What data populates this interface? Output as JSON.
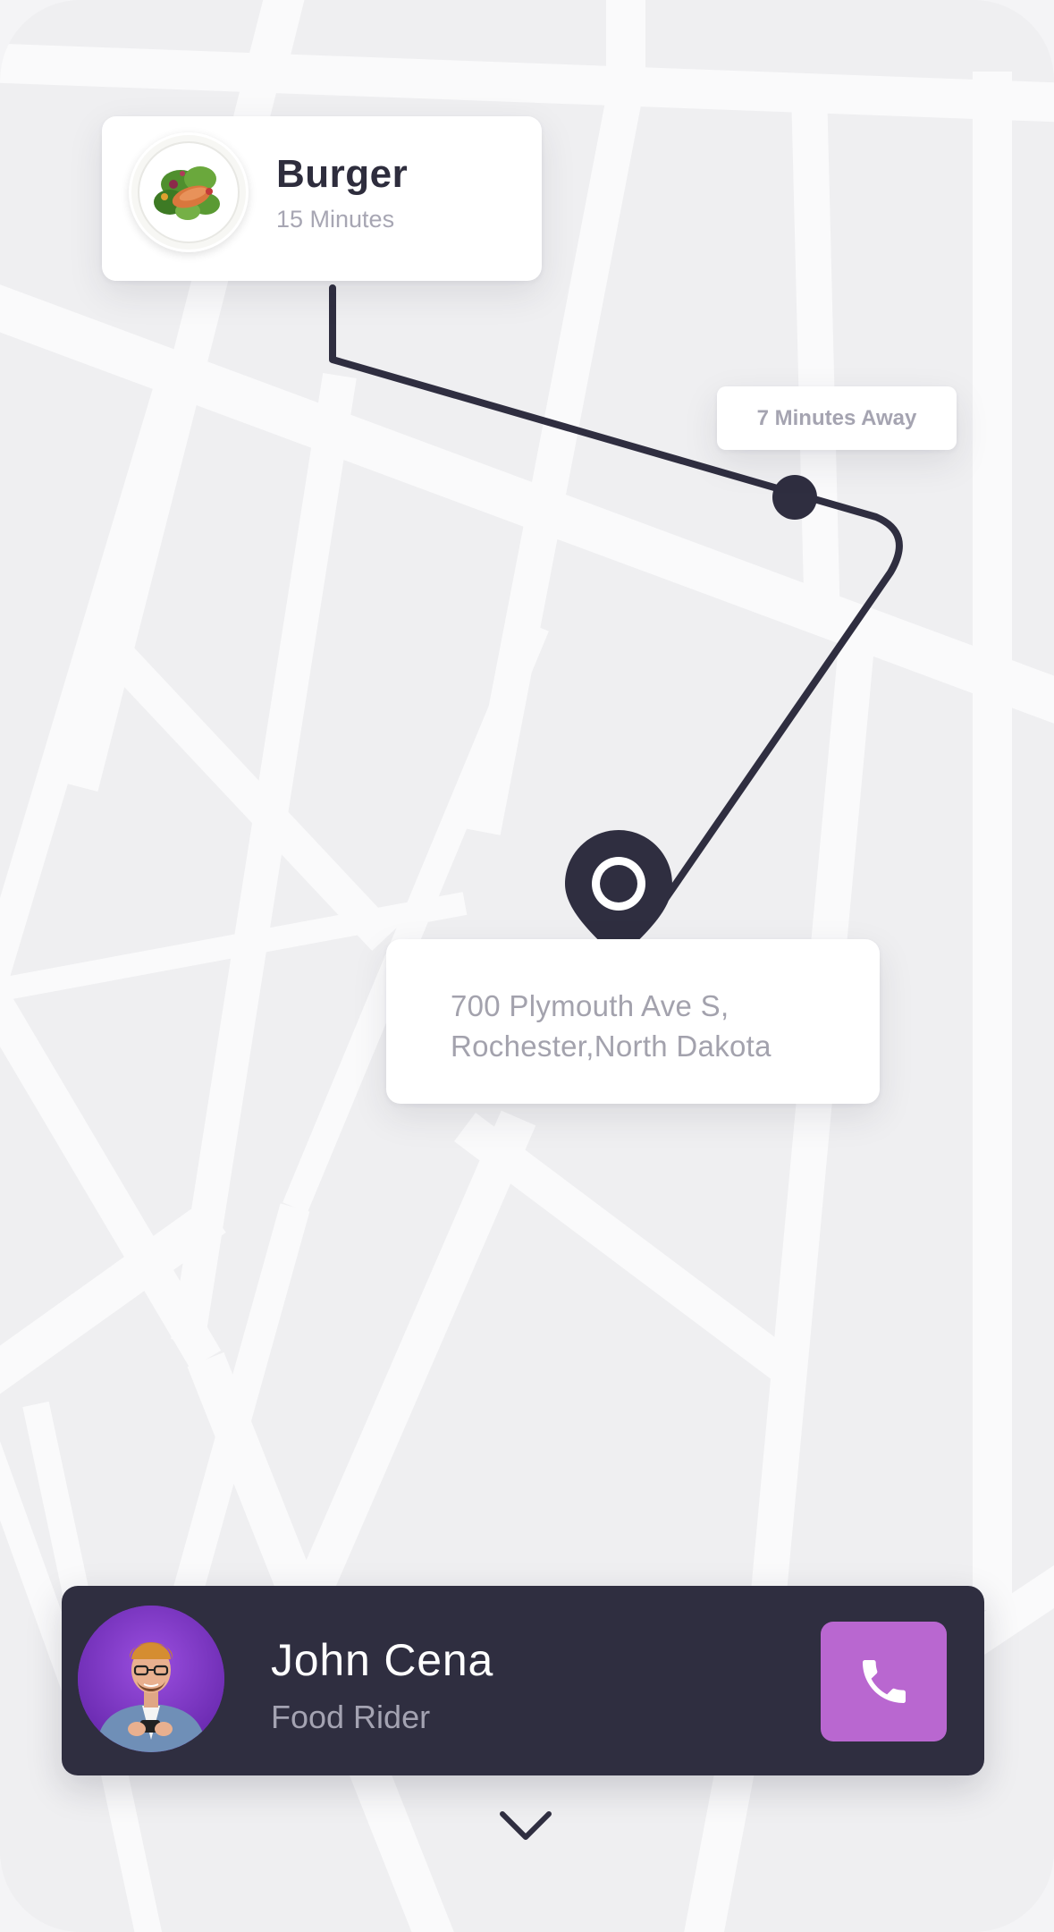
{
  "order": {
    "item_name": "Burger",
    "prep_time": "15 Minutes",
    "image_icon": "food-plate-icon"
  },
  "route": {
    "eta_label": "7 Minutes Away",
    "destination_line1": "700 Plymouth Ave S,",
    "destination_line2": "Rochester,North Dakota",
    "pin_icon": "location-pin-icon"
  },
  "rider": {
    "name": "John Cena",
    "role": "Food Rider",
    "avatar_icon": "rider-avatar",
    "call_icon": "phone-icon"
  },
  "controls": {
    "collapse_icon": "chevron-down-icon"
  },
  "colors": {
    "dark": "#2f2e40",
    "accent": "#b967d0",
    "muted_text": "#a7a6b3",
    "map_bg": "#efeff1",
    "road": "#fafafb"
  }
}
